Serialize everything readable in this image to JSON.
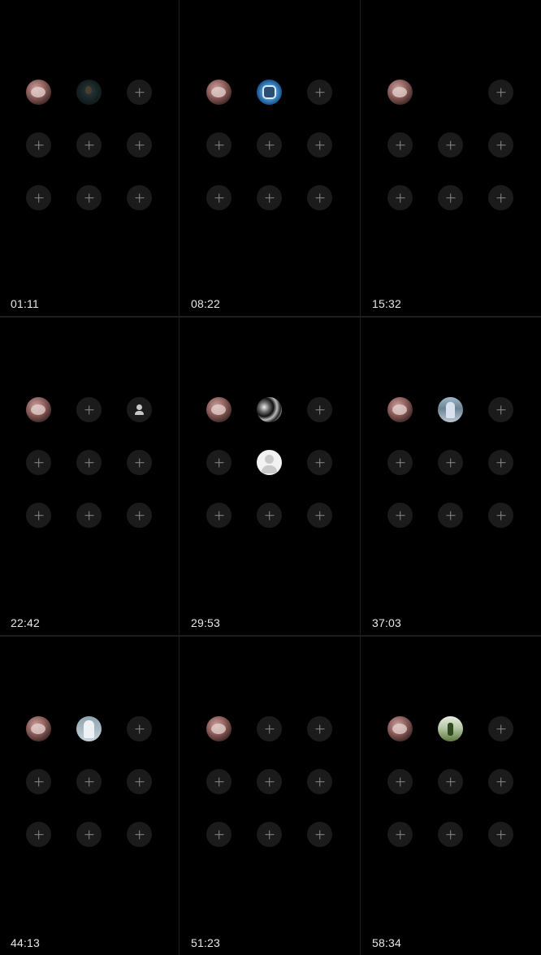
{
  "panels": [
    {
      "timestamp": "01:11",
      "slots": [
        "self",
        "dark",
        "add",
        "add",
        "add",
        "add",
        "add",
        "add",
        "add"
      ]
    },
    {
      "timestamp": "08:22",
      "slots": [
        "self",
        "blue",
        "add",
        "add",
        "add",
        "add",
        "add",
        "add",
        "add"
      ]
    },
    {
      "timestamp": "15:32",
      "slots": [
        "self",
        "none",
        "add",
        "add",
        "add",
        "add",
        "add",
        "add",
        "add"
      ]
    },
    {
      "timestamp": "22:42",
      "slots": [
        "self",
        "add",
        "person-dark",
        "add",
        "add",
        "add",
        "add",
        "add",
        "add"
      ]
    },
    {
      "timestamp": "29:53",
      "slots": [
        "self",
        "bw",
        "add",
        "add",
        "default",
        "add",
        "add",
        "add",
        "add"
      ]
    },
    {
      "timestamp": "37:03",
      "slots": [
        "self",
        "photo1",
        "add",
        "add",
        "add",
        "add",
        "add",
        "add",
        "add"
      ]
    },
    {
      "timestamp": "44:13",
      "slots": [
        "self",
        "photo2",
        "add",
        "add",
        "add",
        "add",
        "add",
        "add",
        "add"
      ]
    },
    {
      "timestamp": "51:23",
      "slots": [
        "self",
        "add",
        "add",
        "add",
        "add",
        "add",
        "add",
        "add",
        "add"
      ]
    },
    {
      "timestamp": "58:34",
      "slots": [
        "self",
        "photo3",
        "add",
        "add",
        "add",
        "add",
        "add",
        "add",
        "add"
      ]
    }
  ]
}
